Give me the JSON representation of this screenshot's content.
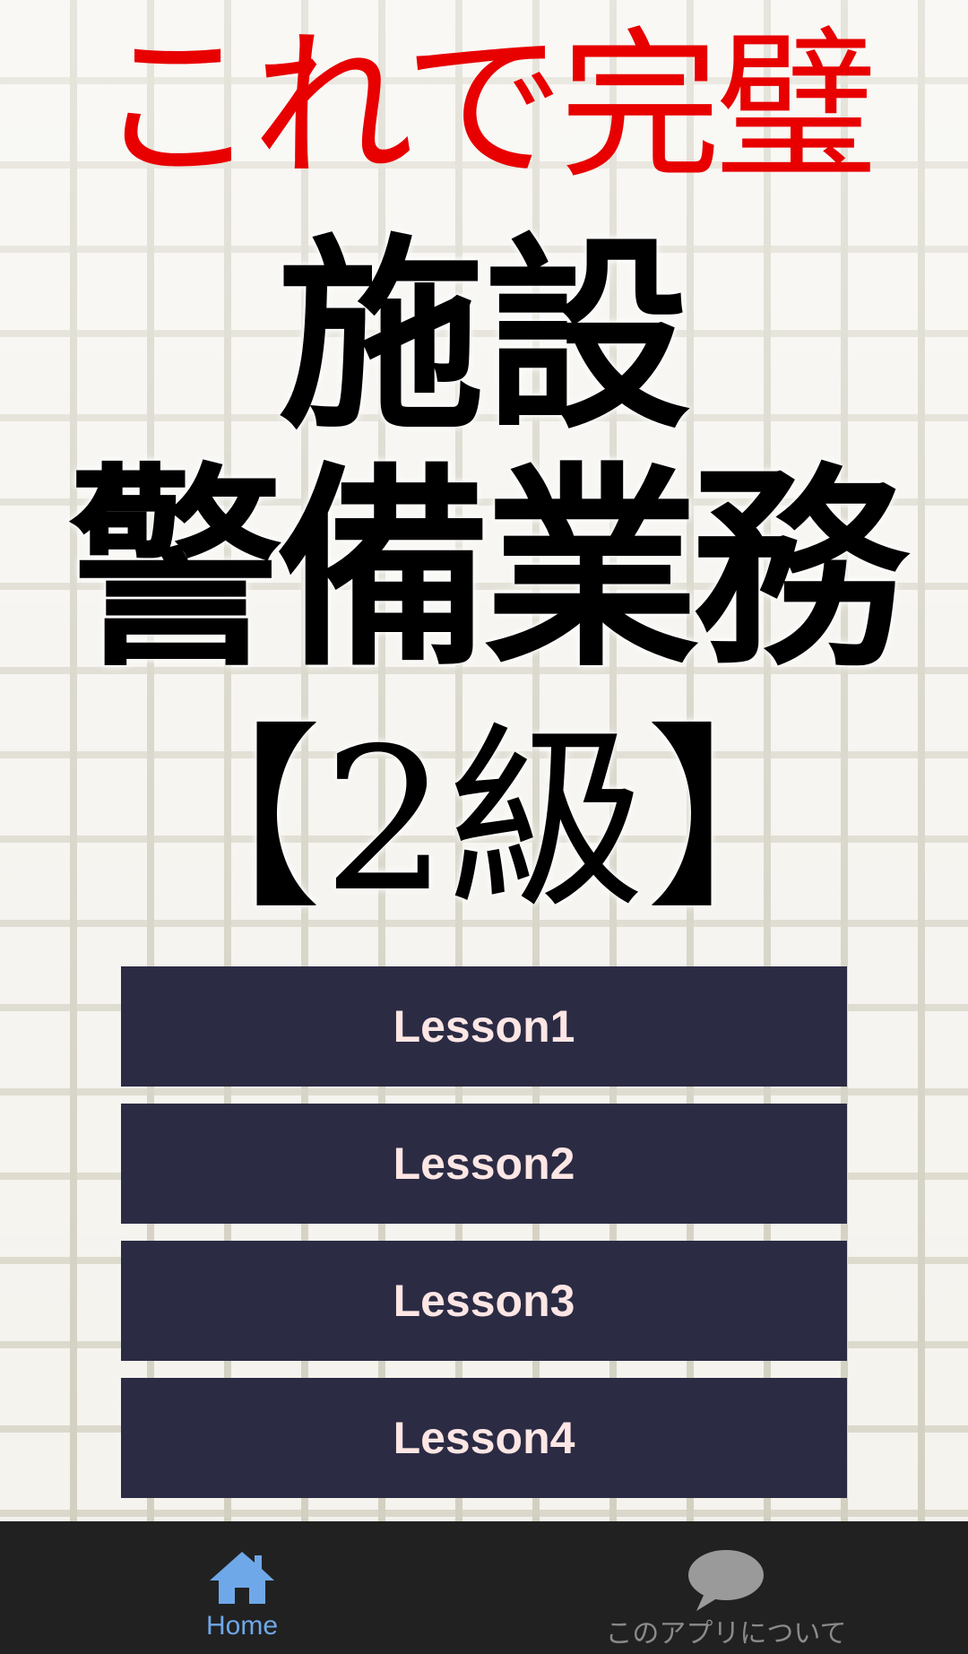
{
  "header": {
    "tagline": "これで完璧",
    "title_line1": "施設",
    "title_line2": "警備業務",
    "title_line3": "【2級】"
  },
  "lessons": [
    {
      "label": "Lesson1"
    },
    {
      "label": "Lesson2"
    },
    {
      "label": "Lesson3"
    },
    {
      "label": "Lesson4"
    }
  ],
  "bottom_nav": {
    "items": [
      {
        "label": "Home",
        "icon": "home-icon",
        "active": true
      },
      {
        "label": "このアプリについて",
        "icon": "chat-bubble-icon",
        "active": false
      }
    ]
  },
  "colors": {
    "tagline": "#e80000",
    "button_bg": "#2b2b44",
    "button_text": "#fde6e4",
    "nav_bg": "#212121",
    "nav_active": "#6fa8e8",
    "nav_inactive": "#8a8a8a"
  }
}
